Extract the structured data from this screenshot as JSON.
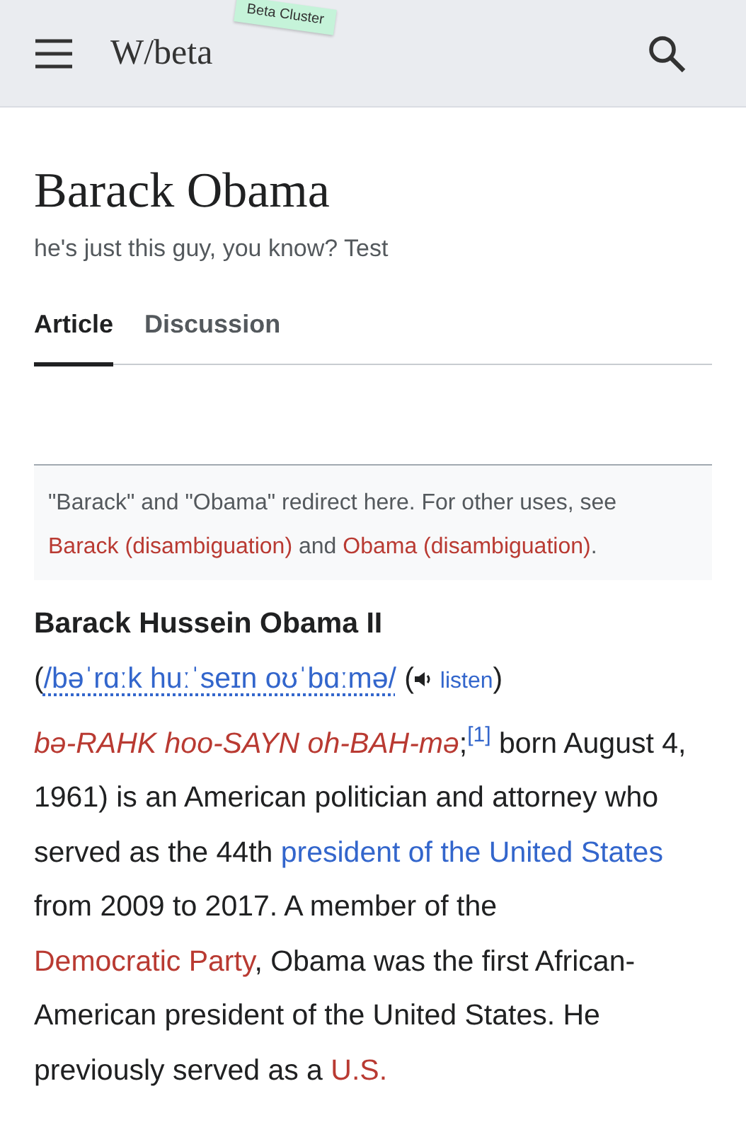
{
  "header": {
    "site_name": "W/beta",
    "badge": "Beta Cluster"
  },
  "title": "Barack Obama",
  "tagline": "he's just this guy, you know? Test",
  "tabs": [
    {
      "label": "Article",
      "selected": true
    },
    {
      "label": "Discussion",
      "selected": false
    }
  ],
  "hatnote": [
    {
      "kind": "text",
      "text": "\"Barack\" and \"Obama\" redirect here. For other uses, see "
    },
    {
      "kind": "redlink",
      "text": "Barack (disambiguation)"
    },
    {
      "kind": "text",
      "text": " and "
    },
    {
      "kind": "redlink",
      "text": "Obama (disambiguation)"
    },
    {
      "kind": "text",
      "text": "."
    }
  ],
  "lead": [
    {
      "kind": "bold",
      "text": "Barack Hussein Obama II"
    },
    {
      "kind": "text",
      "text": " ("
    },
    {
      "kind": "ipa",
      "text": "/bəˈrɑːk huːˈseɪn oʊˈbɑːmə/"
    },
    {
      "kind": "text",
      "text": " ("
    },
    {
      "kind": "audio",
      "text": "listen"
    },
    {
      "kind": "text",
      "text": ") "
    },
    {
      "kind": "respell",
      "text": "bə-RAHK hoo-SAYN oh-BAH-mə"
    },
    {
      "kind": "text",
      "text": ";"
    },
    {
      "kind": "ref",
      "text": "[1]"
    },
    {
      "kind": "text",
      "text": " born August 4, 1961) is an American politician and attorney who served as the 44th "
    },
    {
      "kind": "link",
      "text": "president of the United States"
    },
    {
      "kind": "text",
      "text": " from 2009 to 2017. A member of the "
    },
    {
      "kind": "redlink",
      "text": "Democratic Party"
    },
    {
      "kind": "text",
      "text": ", Obama was the first African-American president of the United States. He previously served as a "
    },
    {
      "kind": "redlink",
      "text": "U.S."
    }
  ]
}
